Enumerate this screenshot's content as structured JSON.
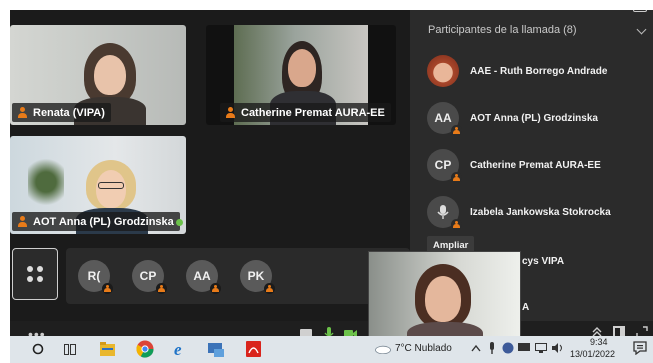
{
  "panel": {
    "title": "Participantes de la llamada (8)",
    "participants": [
      {
        "initials": "",
        "name": "AAE - Ruth Borrego Andrade"
      },
      {
        "initials": "AA",
        "name": "AOT Anna (PL) Grodzinska"
      },
      {
        "initials": "CP",
        "name": "Catherine Premat AURA-EE"
      },
      {
        "initials": "",
        "name": "Izabela Jankowska Stokrocka"
      },
      {
        "initials": "",
        "name": "cys VIPA"
      },
      {
        "initials": "",
        "name": "A"
      }
    ],
    "tooltip": "Ampliar"
  },
  "tiles": [
    {
      "name": "Renata (VIPA)"
    },
    {
      "name": "Catherine Premat AURA-EE"
    },
    {
      "name": "AOT Anna (PL) Grodzinska"
    }
  ],
  "strip": {
    "avatars": [
      {
        "initials": "R("
      },
      {
        "initials": "CP"
      },
      {
        "initials": "AA"
      },
      {
        "initials": "PK"
      }
    ]
  },
  "controls": {
    "more_label": "•••"
  },
  "taskbar": {
    "weather": "7°C  Nublado",
    "time": "9:34",
    "date": "13/01/2022",
    "icons": [
      "windows-icon",
      "task-view-icon",
      "file-explorer-icon",
      "chrome-icon",
      "edge-icon",
      "app-icon",
      "pdf-icon"
    ]
  },
  "colors": {
    "accent_orange": "#e87b19",
    "panel_bg": "#2b2b2b",
    "stage_bg": "#1b1b1b",
    "mic_green": "#6cc24a"
  }
}
